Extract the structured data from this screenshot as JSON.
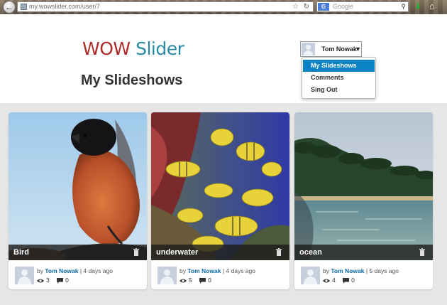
{
  "browser": {
    "url": "my.wowslider.com/user/7",
    "search_placeholder": "Google",
    "search_engine": "G"
  },
  "header": {
    "logo_part1": "WOW",
    "logo_part2": "Slider",
    "page_title": "My Slideshows",
    "user_name": "Tom Nowak"
  },
  "user_menu": {
    "items": [
      {
        "label": "My Slideshows",
        "active": true
      },
      {
        "label": "Comments",
        "active": false
      },
      {
        "label": "Sing Out",
        "active": false
      }
    ]
  },
  "cards": [
    {
      "title": "Bird",
      "by": "by",
      "author": "Tom Nowak",
      "time": "4 days ago",
      "views": "3",
      "comments": "0"
    },
    {
      "title": "underwater",
      "by": "by",
      "author": "Tom Nowak",
      "time": "4 days ago",
      "views": "5",
      "comments": "0"
    },
    {
      "title": "ocean",
      "by": "by",
      "author": "Tom Nowak",
      "time": "5 days ago",
      "views": "4",
      "comments": "0"
    }
  ],
  "colors": {
    "accent": "#0a82c4",
    "logo_red": "#b02a2a",
    "logo_teal": "#2a8aa6",
    "author_link": "#0a6aa8"
  }
}
